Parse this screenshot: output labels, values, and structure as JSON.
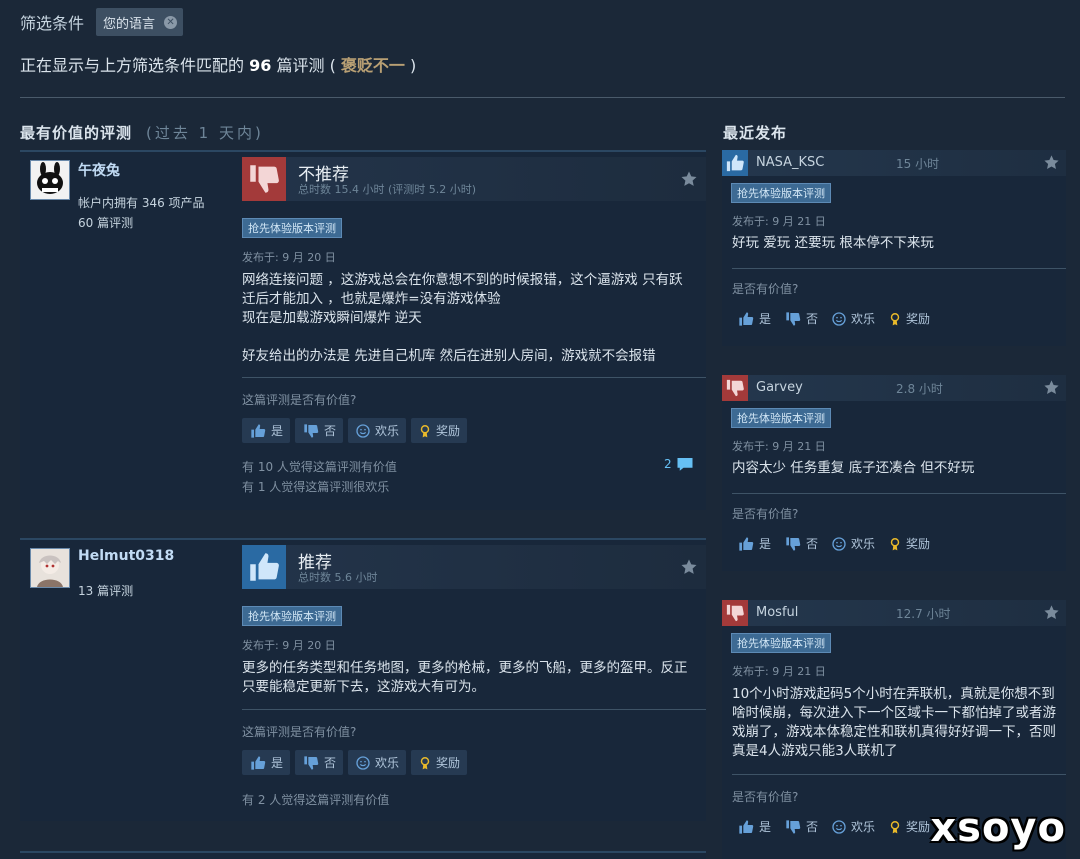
{
  "filter": {
    "label": "筛选条件",
    "chip": "您的语言"
  },
  "summary": {
    "prefix": "正在显示与上方筛选条件匹配的",
    "count": "96",
    "middle": "篇评测",
    "open": "(",
    "rating": "褒贬不一",
    "close": ")"
  },
  "sections": {
    "helpful_title": "最有价值的评测",
    "helpful_period": "(过去 1 天内)",
    "recent_title": "最近发布"
  },
  "colors": {
    "positive": "#66c0f4",
    "negative": "#c43d3d",
    "badge": "#3d6a93"
  },
  "vote_buttons": {
    "yes": "是",
    "no": "否",
    "funny": "欢乐",
    "award": "奖励"
  },
  "helpful_question": "这篇评测是否有价值?",
  "recent_helpful_question": "是否有价值?",
  "reviews": [
    {
      "author": "午夜兔",
      "author_line1": "帐户内拥有 346 项产品",
      "author_line2": "60 篇评测",
      "recommendation": "不推荐",
      "icon": "thumbs-down-icon",
      "hours": "总时数 15.4 小时  (评测时 5.2 小时)",
      "badge": "抢先体验版本评测",
      "posted": "发布于: 9 月 20 日",
      "content": [
        "网络连接问题 ，这游戏总会在你意想不到的时候报错，这个逼游戏 只有跃迁后才能加入 ，也就是爆炸=没有游戏体验",
        "现在是加载游戏瞬间爆炸 逆天",
        "",
        "好友给出的办法是 先进自己机库 然后在进别人房间，游戏就不会报错"
      ],
      "helped_1": "有 10 人觉得这篇评测有价值",
      "helped_2": "有 1 人觉得这篇评测很欢乐",
      "comments": "2"
    },
    {
      "author": "Helmut0318",
      "author_line1": "13 篇评测",
      "recommendation": "推荐",
      "icon": "thumbs-up-icon",
      "hours": "总时数 5.6 小时",
      "badge": "抢先体验版本评测",
      "posted": "发布于: 9 月 20 日",
      "content": [
        "更多的任务类型和任务地图，更多的枪械，更多的飞船，更多的盔甲。反正只要能稳定更新下去，这游戏大有可为。"
      ],
      "helped_1": "有 2 人觉得这篇评测有价值"
    }
  ],
  "recent": [
    {
      "author": "NASA_KSC",
      "hours": "15 小时",
      "icon": "thumbs-up-icon",
      "badge": "抢先体验版本评测",
      "posted": "发布于: 9 月 21 日",
      "content": "好玩 爱玩 还要玩 根本停不下来玩"
    },
    {
      "author": "Garvey",
      "hours": "2.8 小时",
      "icon": "thumbs-down-icon",
      "badge": "抢先体验版本评测",
      "posted": "发布于: 9 月 21 日",
      "content": "内容太少 任务重复 底子还凑合 但不好玩"
    },
    {
      "author": "Mosful",
      "hours": "12.7 小时",
      "icon": "thumbs-down-icon",
      "badge": "抢先体验版本评测",
      "posted": "发布于: 9 月 21 日",
      "content": "10个小时游戏起码5个小时在弄联机，真就是你想不到啥时候崩，每次进入下一个区域卡一下都怕掉了或者游戏崩了，游戏本体稳定性和联机真得好好调一下，否则真是4人游戏只能3人联机了"
    }
  ],
  "watermark": "xsoyo"
}
